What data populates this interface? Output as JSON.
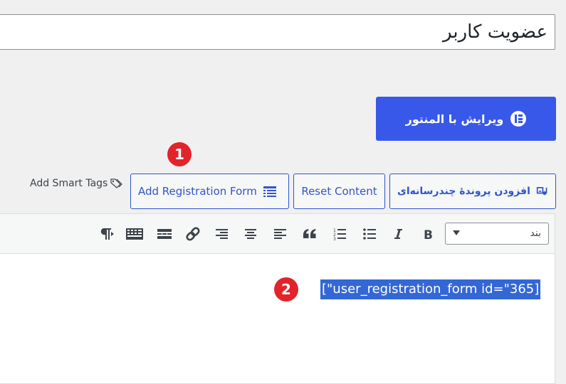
{
  "post_title": "عضویت کاربر",
  "elementor_button": {
    "label": "ویرایش با المنتور",
    "icon": "elementor-icon"
  },
  "annotations": {
    "badge_1": "1",
    "badge_2": "2"
  },
  "media_buttons": {
    "add_media": {
      "label": "افزودن پروندهٔ چندرسانه‌ای",
      "icon": "media-icon"
    },
    "reset_content": {
      "label": "Reset Content"
    },
    "add_registration_form": {
      "label": "Add Registration Form",
      "icon": "form-list-icon"
    },
    "smart_tags": {
      "label": "Add Smart Tags",
      "icon": "tag-icon"
    }
  },
  "toolbar": {
    "format_select": {
      "value": "بند"
    },
    "tools": [
      "bold",
      "italic",
      "bulleted-list",
      "numbered-list",
      "blockquote",
      "align-left",
      "align-center",
      "align-right",
      "insert-link",
      "read-more",
      "toolbar-toggle",
      "paragraph-direction"
    ]
  },
  "editor_content": {
    "shortcode": "[\"user_registration_form id=\"365]"
  },
  "colors": {
    "accent": "#3858e9",
    "link_blue": "#2f56c9",
    "badge_red": "#e2232a",
    "selection": "#3367d6"
  }
}
